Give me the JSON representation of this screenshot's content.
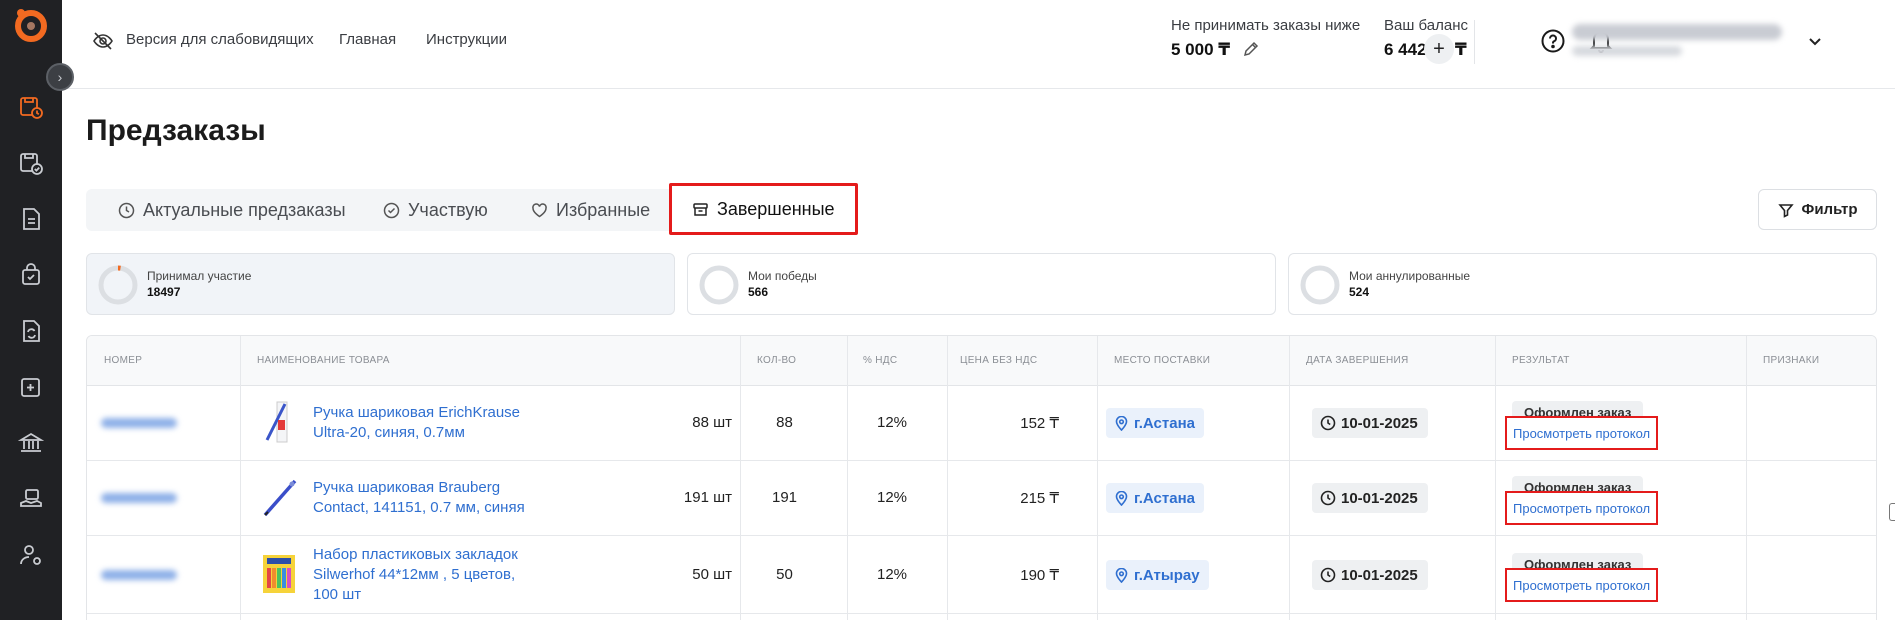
{
  "sidebar": {
    "icons": [
      "orders-clock-icon",
      "orders-check-icon",
      "document-icon",
      "bag-icon",
      "file-refresh-icon",
      "cart-add-icon",
      "bank-icon",
      "hand-money-icon",
      "user-settings-icon"
    ]
  },
  "header": {
    "accessibility_link": "Версия для слабовидящих",
    "home_link": "Главная",
    "instructions_link": "Инструкции",
    "min_order_label": "Не принимать заказы ниже",
    "min_order_value": "5 000 ₸",
    "balance_label": "Ваш баланс",
    "balance_value": "6 442.03 ₸",
    "add_symbol": "+"
  },
  "page_title": "Предзаказы",
  "tabs": [
    {
      "label": "Актуальные предзаказы",
      "icon": "clock-icon"
    },
    {
      "label": "Участвую",
      "icon": "check-circle-icon"
    },
    {
      "label": "Избранные",
      "icon": "heart-icon"
    },
    {
      "label": "Завершенные",
      "icon": "archive-icon",
      "active": true
    }
  ],
  "filter_label": "Фильтр",
  "stats": [
    {
      "label": "Принимал участие",
      "value": "18497"
    },
    {
      "label": "Мои победы",
      "value": "566"
    },
    {
      "label": "Мои аннулированные",
      "value": "524"
    }
  ],
  "table": {
    "headers": [
      "НОМЕР",
      "НАИМЕНОВАНИЕ ТОВАРА",
      "КОЛ-ВО",
      "% НДС",
      "ЦЕНА БЕЗ НДС",
      "МЕСТО ПОСТАВКИ",
      "ДАТА ЗАВЕРШЕНИЯ",
      "РЕЗУЛЬТАТ",
      "ПРИЗНАКИ"
    ],
    "rows": [
      {
        "name_line1": "Ручка шариковая ErichKrause",
        "name_line2": "Ultra-20, синяя, 0.7мм",
        "name_line3": "",
        "qty_text": "88 шт",
        "qty": "88",
        "nds": "12%",
        "price": "152 ₸",
        "place": "г.Астана",
        "date": "10-01-2025",
        "result": "Оформлен заказ",
        "protocol": "Просмотреть протокол"
      },
      {
        "name_line1": "Ручка шариковая Brauberg",
        "name_line2": "Contact, 141151, 0.7 мм, синяя",
        "name_line3": "",
        "qty_text": "191 шт",
        "qty": "191",
        "nds": "12%",
        "price": "215 ₸",
        "place": "г.Астана",
        "date": "10-01-2025",
        "result": "Оформлен заказ",
        "protocol": "Просмотреть протокол"
      },
      {
        "name_line1": "Набор пластиковых закладок",
        "name_line2": "Silwerhof 44*12мм , 5 цветов,",
        "name_line3": "100 шт",
        "qty_text": "50 шт",
        "qty": "50",
        "nds": "12%",
        "price": "190 ₸",
        "place": "г.Атырау",
        "date": "10-01-2025",
        "result": "Оформлен заказ",
        "protocol": "Просмотреть протокол"
      }
    ]
  },
  "colors": {
    "sidebar_bg": "#202124",
    "accent_orange": "#f26a21",
    "link_blue": "#2f6fd0",
    "highlight_red": "#e41b1b"
  }
}
